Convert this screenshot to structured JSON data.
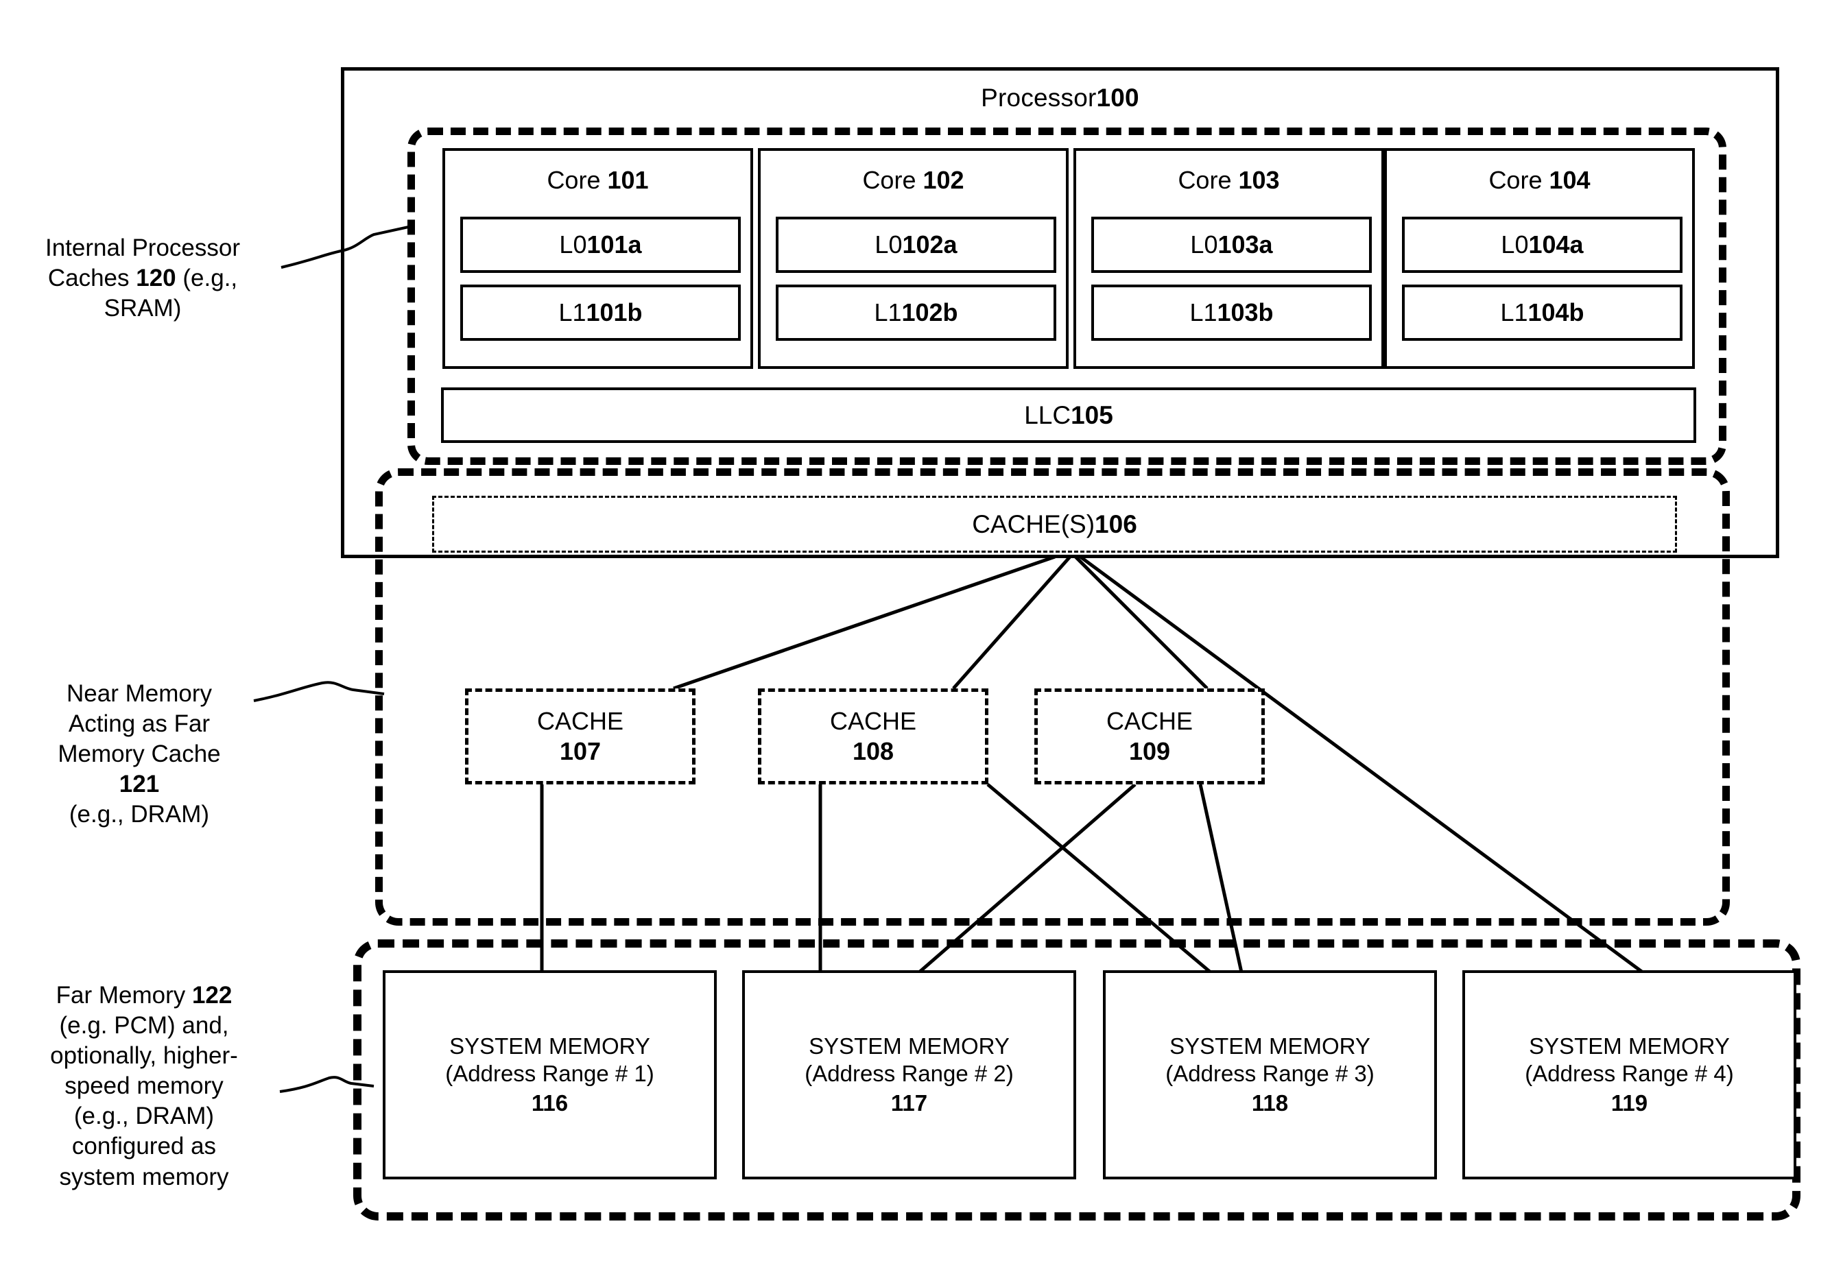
{
  "figure": {
    "processor": {
      "title_prefix": "Processor ",
      "title_ref": "100"
    },
    "cores": [
      {
        "name": "Core ",
        "ref": "101",
        "l0_label": "L0 ",
        "l0_ref": "101a",
        "l1_label": "L1 ",
        "l1_ref": "101b"
      },
      {
        "name": "Core ",
        "ref": "102",
        "l0_label": "L0 ",
        "l0_ref": "102a",
        "l1_label": "L1 ",
        "l1_ref": "102b"
      },
      {
        "name": "Core ",
        "ref": "103",
        "l0_label": "L0 ",
        "l0_ref": "103a",
        "l1_label": "L1 ",
        "l1_ref": "103b"
      },
      {
        "name": "Core ",
        "ref": "104",
        "l0_label": "L0 ",
        "l0_ref": "104a",
        "l1_label": "L1 ",
        "l1_ref": "104b"
      }
    ],
    "llc": {
      "label": "LLC ",
      "ref": "105"
    },
    "caches_shared": {
      "label": "CACHE(S) ",
      "ref": "106"
    },
    "mid_caches": [
      {
        "label": "CACHE",
        "ref": "107"
      },
      {
        "label": "CACHE",
        "ref": "108"
      },
      {
        "label": "CACHE",
        "ref": "109"
      }
    ],
    "system_memories": [
      {
        "line1": "SYSTEM MEMORY",
        "line2": "(Address Range # 1)",
        "ref": "116"
      },
      {
        "line1": "SYSTEM MEMORY",
        "line2": "(Address Range # 2)",
        "ref": "117"
      },
      {
        "line1": "SYSTEM MEMORY",
        "line2": "(Address Range # 3)",
        "ref": "118"
      },
      {
        "line1": "SYSTEM MEMORY",
        "line2": "(Address Range # 4)",
        "ref": "119"
      }
    ],
    "annotations": {
      "internal_caches": {
        "line1": "Internal Processor",
        "line2_pre": "Caches ",
        "line2_ref": "120",
        "line2_post": " (e.g.,",
        "line3": "SRAM)"
      },
      "near_memory": {
        "line1": "Near Memory",
        "line2": "Acting as Far",
        "line3": "Memory Cache",
        "line4_ref": "121",
        "line5": "(e.g., DRAM)"
      },
      "far_memory": {
        "line1_pre": "Far Memory ",
        "line1_ref": "122",
        "line2": "(e.g. PCM) and,",
        "line3": "optionally, higher-",
        "line4": "speed memory",
        "line5": "(e.g., DRAM)",
        "line6": "configured as",
        "line7": "system memory"
      }
    },
    "colors": {
      "stroke": "#000000",
      "background": "#ffffff"
    }
  }
}
